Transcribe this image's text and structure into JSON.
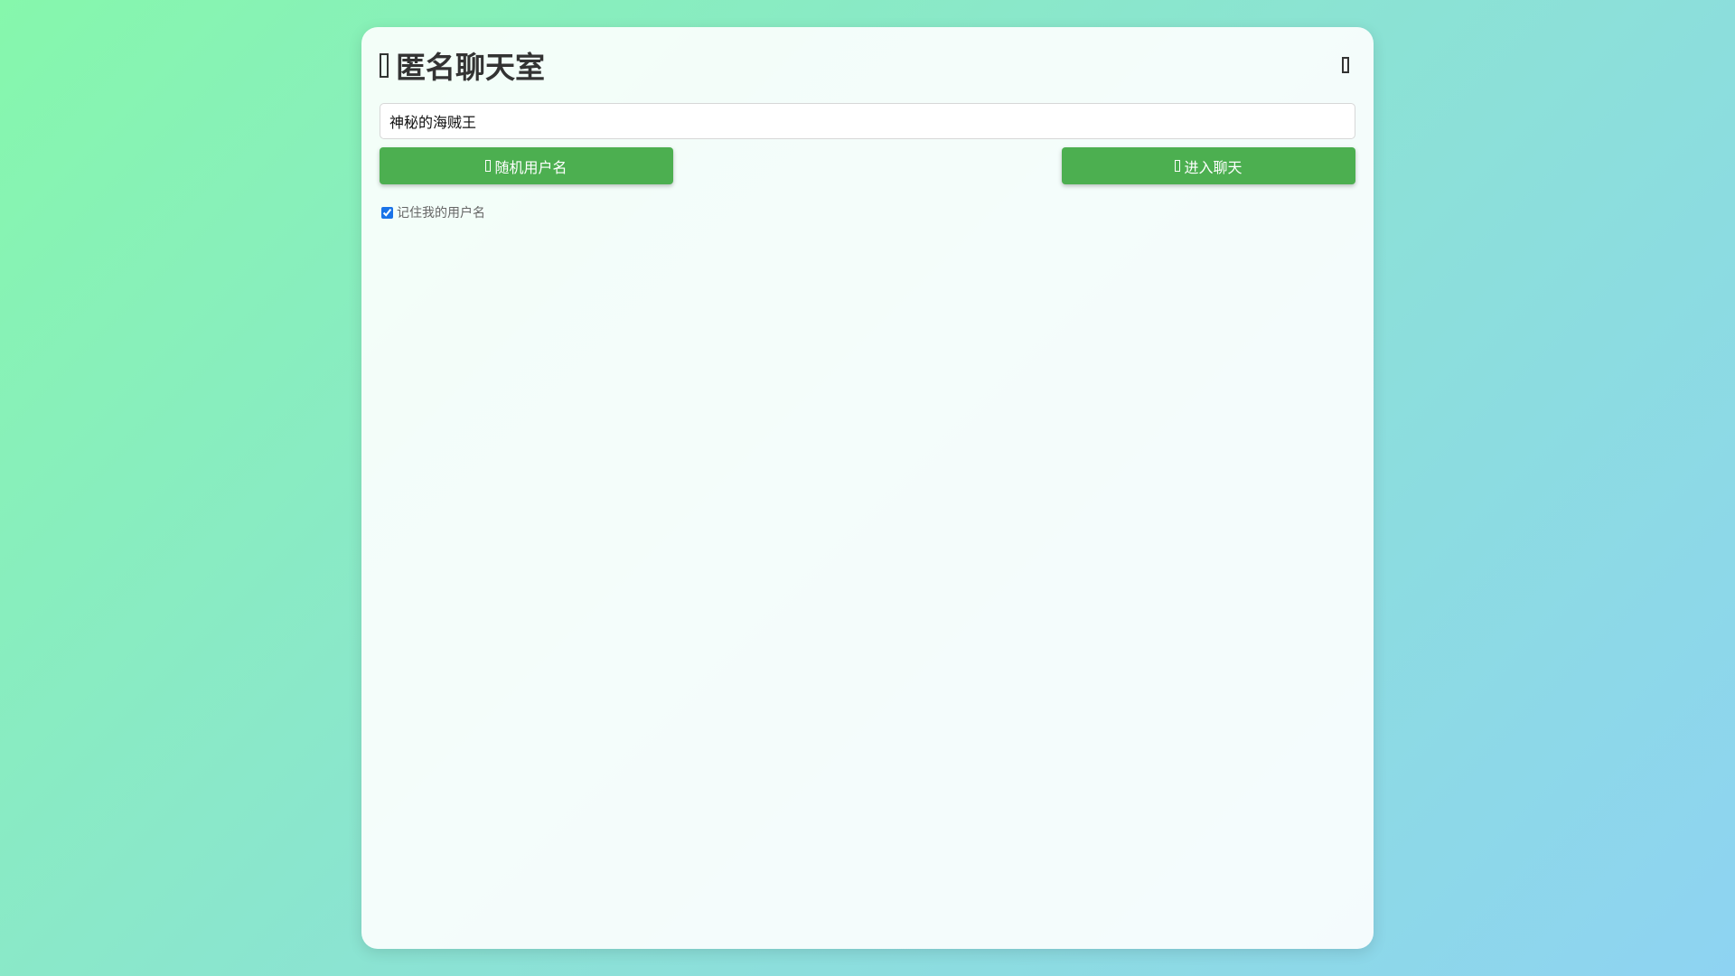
{
  "app": {
    "title": "匿名聊天室",
    "title_icon": "chat-icon",
    "settings_icon": "settings-icon"
  },
  "login": {
    "username_value": "神秘的海贼王",
    "random_button_label": "随机用户名",
    "random_button_icon": "dice-icon",
    "enter_button_label": "进入聊天",
    "enter_button_icon": "enter-icon",
    "remember_label": "记住我的用户名",
    "remember_checked": true
  },
  "colors": {
    "accent": "#4caf50",
    "checkbox": "#1a73e8",
    "title_text": "#333333"
  }
}
